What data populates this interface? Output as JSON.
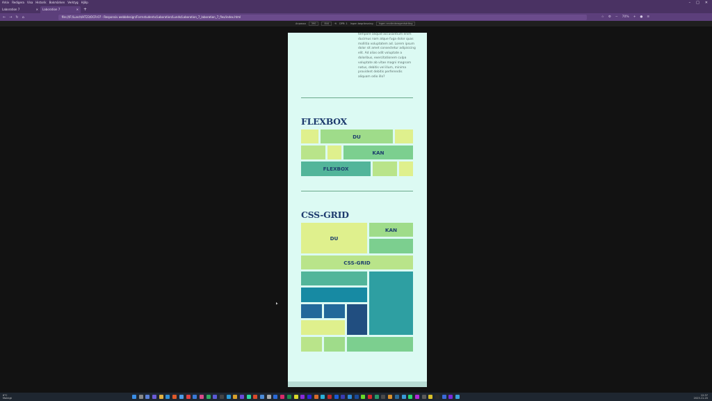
{
  "browser": {
    "menu": [
      "Arkiv",
      "Redigera",
      "Visa",
      "Historik",
      "Bokmärken",
      "Verktyg",
      "Hjälp"
    ],
    "tabs": [
      {
        "label": "Laboration 7",
        "active": false
      },
      {
        "label": "Laboration 7",
        "active": true
      }
    ],
    "new_tab_label": "+",
    "url": "file:///F:/Lunch/HT23/OCR-07 - Responsiv webbdesign/Forrnstudentv/Laboration/Lunds/Laboration_7_laboration_7_flex/index.html",
    "zoom": "70%",
    "devtools": {
      "device": "Anpassa",
      "width": "390",
      "height": "844",
      "dpr": "DPR: 1",
      "throttle": "Ingen begränsning",
      "touch_label": "Ingen användaragentsträng"
    }
  },
  "page": {
    "lorem_lines": [
      "tempore aliquid accusantium enim",
      "ducimus nam atque fuga dolor quas",
      "mollitia voluptatem ad. Lorem ipsum",
      "dolor sit amet consectetur adipisicing",
      "elit. Ad alias odit voluptate a",
      "doloribus, exercitationem culpa",
      "voluptate ab vitae magni magnam",
      "natus, debitis vel illum, minima",
      "provident debitis perferendis",
      "aliquam odio illo?"
    ],
    "flexbox_heading": "FLEXBOX",
    "flexbox_cells": {
      "du": "DU",
      "kan": "KAN",
      "flexbox": "FLEXBOX"
    },
    "grid_heading": "CSS-GRID",
    "grid_cells": {
      "du": "DU",
      "kan": "KAN",
      "cssgrid": "CSS-GRID"
    }
  },
  "colors": {
    "page_bg": "#dcfaf3",
    "heading": "#1d3b6e",
    "browser_chrome": "#4a3263"
  },
  "taskbar": {
    "weather_temp": "6°C",
    "weather_desc": "Molnigt",
    "time": "12:37",
    "date": "2023-11-20"
  }
}
